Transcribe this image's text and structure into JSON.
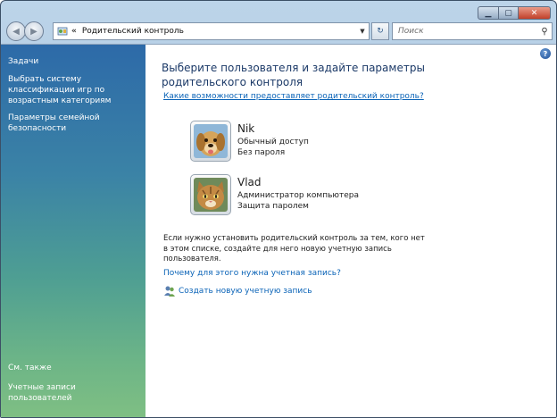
{
  "window": {
    "controls": {
      "minimize": "▁",
      "maximize": "▢",
      "close": "✕"
    }
  },
  "address_bar": {
    "chevron": "«",
    "path": "Родительский контроль",
    "search_placeholder": "Поиск"
  },
  "sidebar": {
    "tasks_heading": "Задачи",
    "links": [
      "Выбрать систему классификации игр по возрастным категориям",
      "Параметры семейной безопасности"
    ],
    "see_also_heading": "См. также",
    "see_also_links": [
      "Учетные записи пользователей"
    ]
  },
  "main": {
    "title": "Выберите пользователя и задайте параметры родительского контроля",
    "top_link": "Какие возможности предоставляет родительский контроль?",
    "users": [
      {
        "name": "Nik",
        "line1": "Обычный доступ",
        "line2": "Без пароля",
        "picture": "dog-avatar"
      },
      {
        "name": "Vlad",
        "line1": "Администратор компьютера",
        "line2": "Защита паролем",
        "picture": "cat-avatar"
      }
    ],
    "info_text": "Если нужно установить родительский контроль за тем, кого нет в этом списке, создайте для него новую учетную запись пользователя.",
    "why_link": "Почему для этого нужна учетная запись?",
    "create_link": "Создать новую учетную запись"
  },
  "help_icon_text": "?",
  "colors": {
    "link": "#0a63b7",
    "title": "#1c3a68",
    "sidebar_top": "#2d6aa8",
    "sidebar_bottom": "#7fbf83"
  }
}
